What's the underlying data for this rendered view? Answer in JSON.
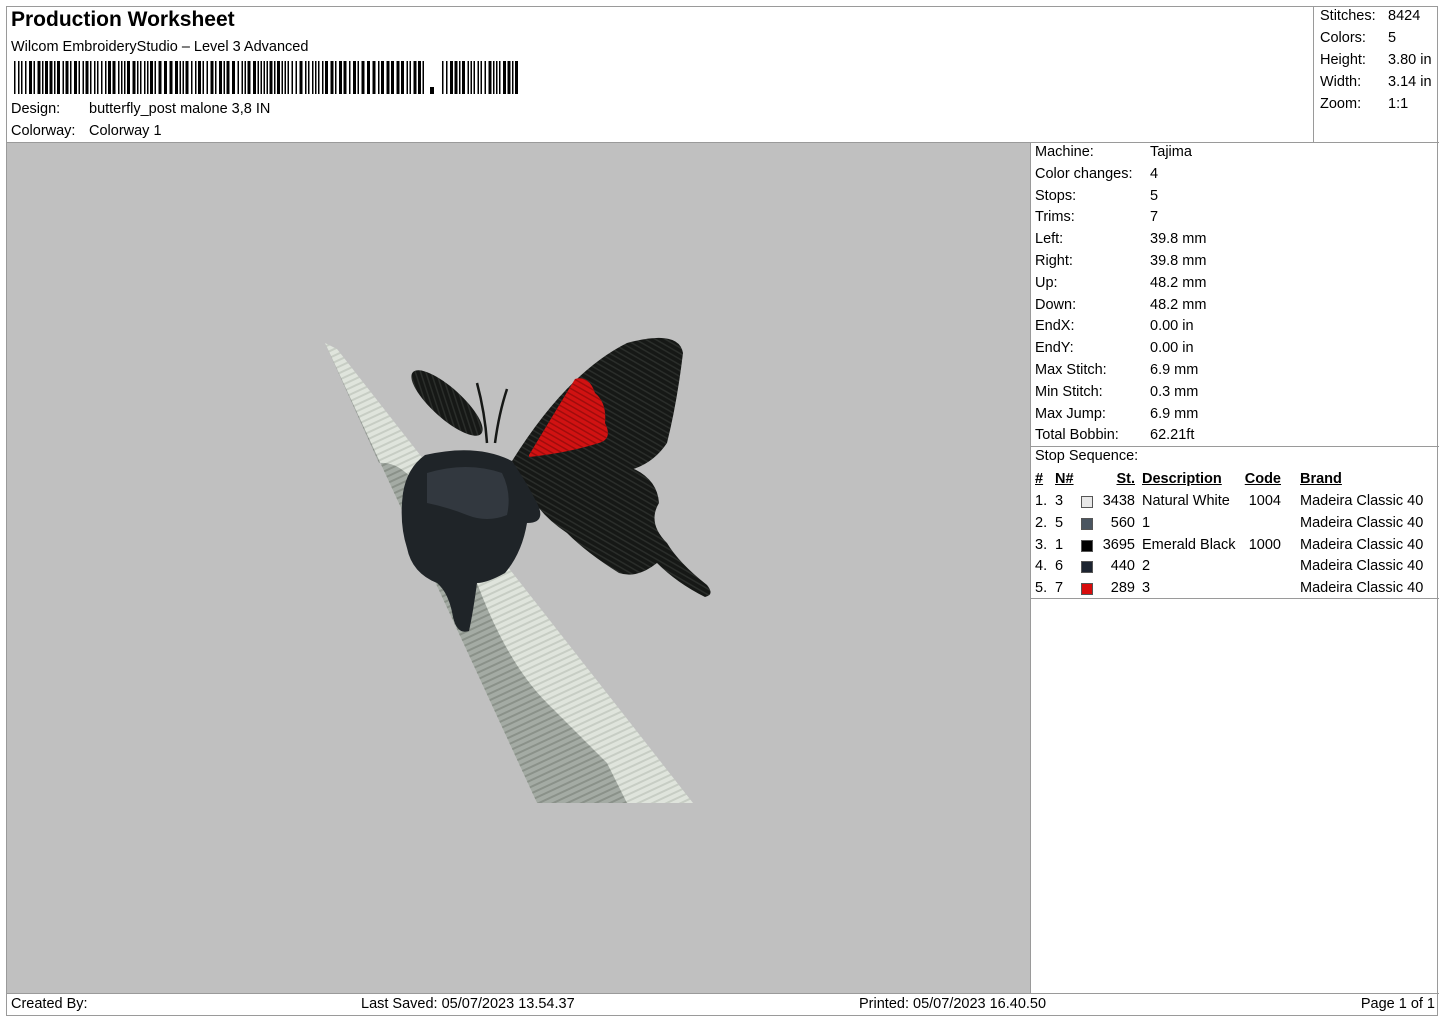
{
  "header": {
    "title": "Production Worksheet",
    "subtitle": "Wilcom EmbroideryStudio – Level 3 Advanced",
    "design_label": "Design:",
    "design_value": "butterfly_post malone 3,8 IN",
    "colorway_label": "Colorway:",
    "colorway_value": "Colorway 1"
  },
  "stats": [
    {
      "label": "Stitches:",
      "value": "8424"
    },
    {
      "label": "Colors:",
      "value": "5"
    },
    {
      "label": "Height:",
      "value": "3.80 in"
    },
    {
      "label": "Width:",
      "value": "3.14 in"
    },
    {
      "label": "Zoom:",
      "value": "1:1"
    }
  ],
  "info": [
    {
      "label": "Machine:",
      "value": "Tajima"
    },
    {
      "label": "Color changes:",
      "value": "4"
    },
    {
      "label": "Stops:",
      "value": "5"
    },
    {
      "label": "Trims:",
      "value": "7"
    },
    {
      "label": "Left:",
      "value": "39.8 mm"
    },
    {
      "label": "Right:",
      "value": "39.8 mm"
    },
    {
      "label": "Up:",
      "value": "48.2 mm"
    },
    {
      "label": "Down:",
      "value": "48.2 mm"
    },
    {
      "label": "EndX:",
      "value": "0.00 in"
    },
    {
      "label": "EndY:",
      "value": "0.00 in"
    },
    {
      "label": "Max Stitch:",
      "value": "6.9 mm"
    },
    {
      "label": "Min Stitch:",
      "value": "0.3 mm"
    },
    {
      "label": "Max Jump:",
      "value": "6.9 mm"
    },
    {
      "label": "Total Bobbin:",
      "value": "62.21ft"
    }
  ],
  "sequence": {
    "title": "Stop Sequence:",
    "headers": {
      "idx": "#",
      "n": "N#",
      "st": "St.",
      "desc": "Description",
      "code": "Code",
      "brand": "Brand"
    },
    "rows": [
      {
        "idx": "1.",
        "n": "3",
        "color": "#e8e8e8",
        "st": "3438",
        "desc": "Natural White",
        "code": "1004",
        "brand": "Madeira Classic 40"
      },
      {
        "idx": "2.",
        "n": "5",
        "color": "#4a5560",
        "st": "560",
        "desc": "1",
        "code": "",
        "brand": "Madeira Classic 40"
      },
      {
        "idx": "3.",
        "n": "1",
        "color": "#000000",
        "st": "3695",
        "desc": "Emerald Black",
        "code": "1000",
        "brand": "Madeira Classic 40"
      },
      {
        "idx": "4.",
        "n": "6",
        "color": "#1c2430",
        "st": "440",
        "desc": "2",
        "code": "",
        "brand": "Madeira Classic 40"
      },
      {
        "idx": "5.",
        "n": "7",
        "color": "#d80c0c",
        "st": "289",
        "desc": "3",
        "code": "",
        "brand": "Madeira Classic 40"
      }
    ]
  },
  "footer": {
    "created_by": "Created By:",
    "last_saved": "Last Saved: 05/07/2023 13.54.37",
    "printed": "Printed: 05/07/2023 16.40.50",
    "page": "Page 1 of 1"
  }
}
